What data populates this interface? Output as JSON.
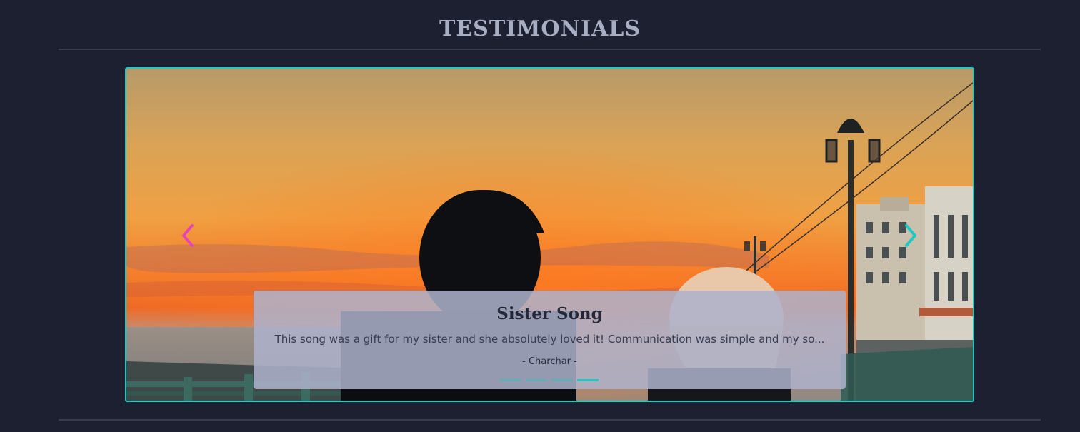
{
  "section": {
    "title": "TESTIMONIALS"
  },
  "carousel": {
    "accent_color": "#1fc8c0",
    "prev_arrow_color": "#e546b5",
    "next_arrow_color": "#1fc8c0",
    "prev_icon": "chevron-left-icon",
    "next_icon": "chevron-right-icon",
    "active_index": 3,
    "slide_count": 4,
    "slide": {
      "title": "Sister Song",
      "quote": "This song was a gift for my sister and she absolutely loved it! Communication was simple and my so...",
      "author": "- Charchar -"
    }
  }
}
